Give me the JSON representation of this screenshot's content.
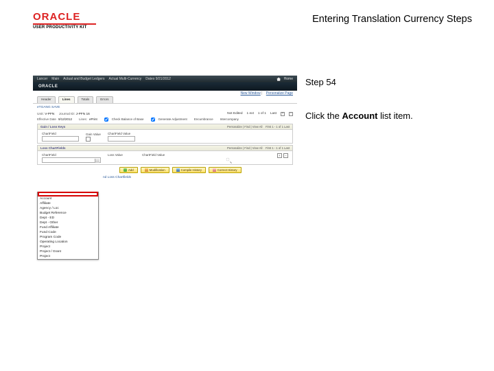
{
  "header": {
    "brand": "ORACLE",
    "brand_sub": "USER PRODUCTIVITY KIT",
    "doc_title": "Entering Translation Currency Steps"
  },
  "instructions": {
    "step_label": "Step 54",
    "desc_pre": "Click the ",
    "desc_bold": "Account",
    "desc_post": " list item."
  },
  "mini": {
    "top_menu": [
      "Lancer",
      "Main",
      "Actual and Budget Ledgers",
      "Actual Multi-Currency",
      "Dates 9/21/2012"
    ],
    "home_label": "Home",
    "oracle": "ORACLE",
    "sublink_a": "New Window",
    "sublink_b": "Personalize Page",
    "tabs": [
      "Header",
      "Lines",
      "Totals",
      "Errors"
    ],
    "crumb": "eTGANG SAVE",
    "unit_label": "Unit:",
    "unit_val": "V-PFN",
    "jid_label": "Journal ID:",
    "jid_val": "J-PFN 16",
    "right_summary": {
      "l1": "Not Edited",
      "l2": "1 ext",
      "l3": "1 of 1",
      "l4": "Last"
    },
    "row2": {
      "eff_label": "Effective Date",
      "eff_val": "9/12/2012",
      "lines_label": "Lines:",
      "lines_val": "ePrint",
      "chk1_label": "Check Balance of Base",
      "chk2_label": "Generate Adjustment",
      "enc_label": "Encumbrance",
      "int_label": "Intercompany"
    },
    "g1_title": "Gain / Loss Keys",
    "g1_tools": "Personalize | Find | View All",
    "g1_first": "First",
    "g1_nav": "1 - 1 of 1",
    "g1_last": "Last",
    "g1_cols": {
      "c1": "ChartField",
      "c2": "Gain Value",
      "c3": "ChartField Value"
    },
    "g2_title": "Loss ChartFields",
    "g2_cols": {
      "c1": "ChartField",
      "c2": "Loss Value",
      "c3": "ChartField Value"
    },
    "dropdown_items": [
      "Account",
      "Affiliate",
      "Agency / Loc",
      "Budget Reference",
      "Dept - ED",
      "Dept - Other",
      "Fund Affiliate",
      "Fund Code",
      "Program Code",
      "Operating Location",
      "Project",
      "Project / Grant",
      "Project"
    ],
    "buttons": {
      "b1": "Add",
      "b2": "Modification",
      "b3": "Compile History",
      "b4": "Correct History"
    },
    "bottom_link": "nd Loss Chartfields"
  }
}
